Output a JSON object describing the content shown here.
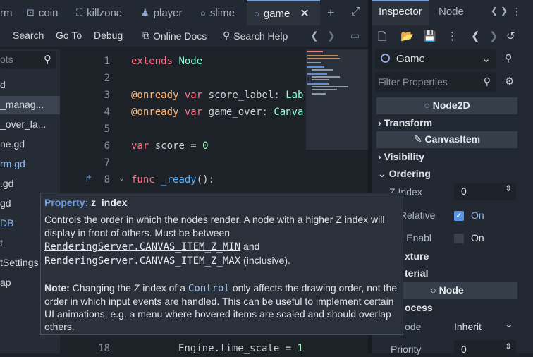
{
  "tabs": [
    {
      "label": "rm",
      "icon": "script-icon"
    },
    {
      "label": "coin",
      "icon": "node2d-icon"
    },
    {
      "label": "killzone",
      "icon": "area-icon"
    },
    {
      "label": "player",
      "icon": "character-icon"
    },
    {
      "label": "slime",
      "icon": "node-icon"
    },
    {
      "label": "game",
      "icon": "node-icon",
      "active": true
    }
  ],
  "menu": {
    "search": "Search",
    "goto": "Go To",
    "debug": "Debug",
    "online_docs": "Online Docs",
    "search_help": "Search Help"
  },
  "script_filter": "ots",
  "scripts": [
    {
      "label": "d"
    },
    {
      "label": "_manag...",
      "selected": true
    },
    {
      "label": "_over_la..."
    },
    {
      "label": "ne.gd"
    },
    {
      "label": "rm.gd",
      "blue": true
    },
    {
      "label": ".gd"
    },
    {
      "label": "gd"
    },
    {
      "label": "DB",
      "blue": true
    },
    {
      "label": "t"
    },
    {
      "label": "tSettings"
    },
    {
      "label": "ap"
    }
  ],
  "code": {
    "lines": [
      {
        "n": "1",
        "text": "extends Node"
      },
      {
        "n": "2",
        "text": ""
      },
      {
        "n": "3",
        "text": "@onready var score_label: Lab"
      },
      {
        "n": "4",
        "text": "@onready var game_over: Canva"
      },
      {
        "n": "5",
        "text": ""
      },
      {
        "n": "6",
        "text": "var score = 0"
      },
      {
        "n": "7",
        "text": ""
      },
      {
        "n": "8",
        "text": "func _ready():"
      },
      {
        "n": "18",
        "text": "Engine.time_scale = 1"
      }
    ]
  },
  "inspector": {
    "tab_inspector": "Inspector",
    "tab_node": "Node",
    "object": "Game",
    "filter_placeholder": "Filter Properties",
    "section_node2d": "Node2D",
    "group_transform": "Transform",
    "section_canvasitem": "CanvasItem",
    "group_visibility": "Visibility",
    "group_ordering": "Ordering",
    "prop_zindex_label": "Z Index",
    "prop_zindex_value": "0",
    "prop_zrel_label": "s Relative",
    "prop_zrel_value": "On",
    "prop_ysort_label": "ort Enabl",
    "prop_ysort_value": "On",
    "group_texture": "xture",
    "group_material": "terial",
    "section_node": "Node",
    "group_process": "ocess",
    "prop_mode_label": "ode",
    "prop_mode_value": "Inherit",
    "prop_priority_label": "Priority",
    "prop_priority_value": "0"
  },
  "tooltip": {
    "prefix": "Property:",
    "name": "z_index",
    "body1": "Controls the order in which the nodes render. A node with a higher Z index will display in front of others. Must be between",
    "const_min": "RenderingServer.CANVAS_ITEM_Z_MIN",
    "and": "and",
    "const_max": "RenderingServer.CANVAS_ITEM_Z_MAX",
    "inclusive": "(inclusive).",
    "note_label": "Note:",
    "note1": "Changing the Z index of a",
    "note_control": "Control",
    "note2": "only affects the drawing order, not the order in which input events are handled. This can be useful to implement certain UI animations, e.g. a menu where hovered items are scaled and should overlap others."
  },
  "colors": {
    "accent": "#6f9de0",
    "keyword": "#ff7185",
    "type": "#8effda",
    "function": "#57b3ff",
    "annotation": "#ffb373",
    "checkbox_on": "#5a96e6"
  }
}
